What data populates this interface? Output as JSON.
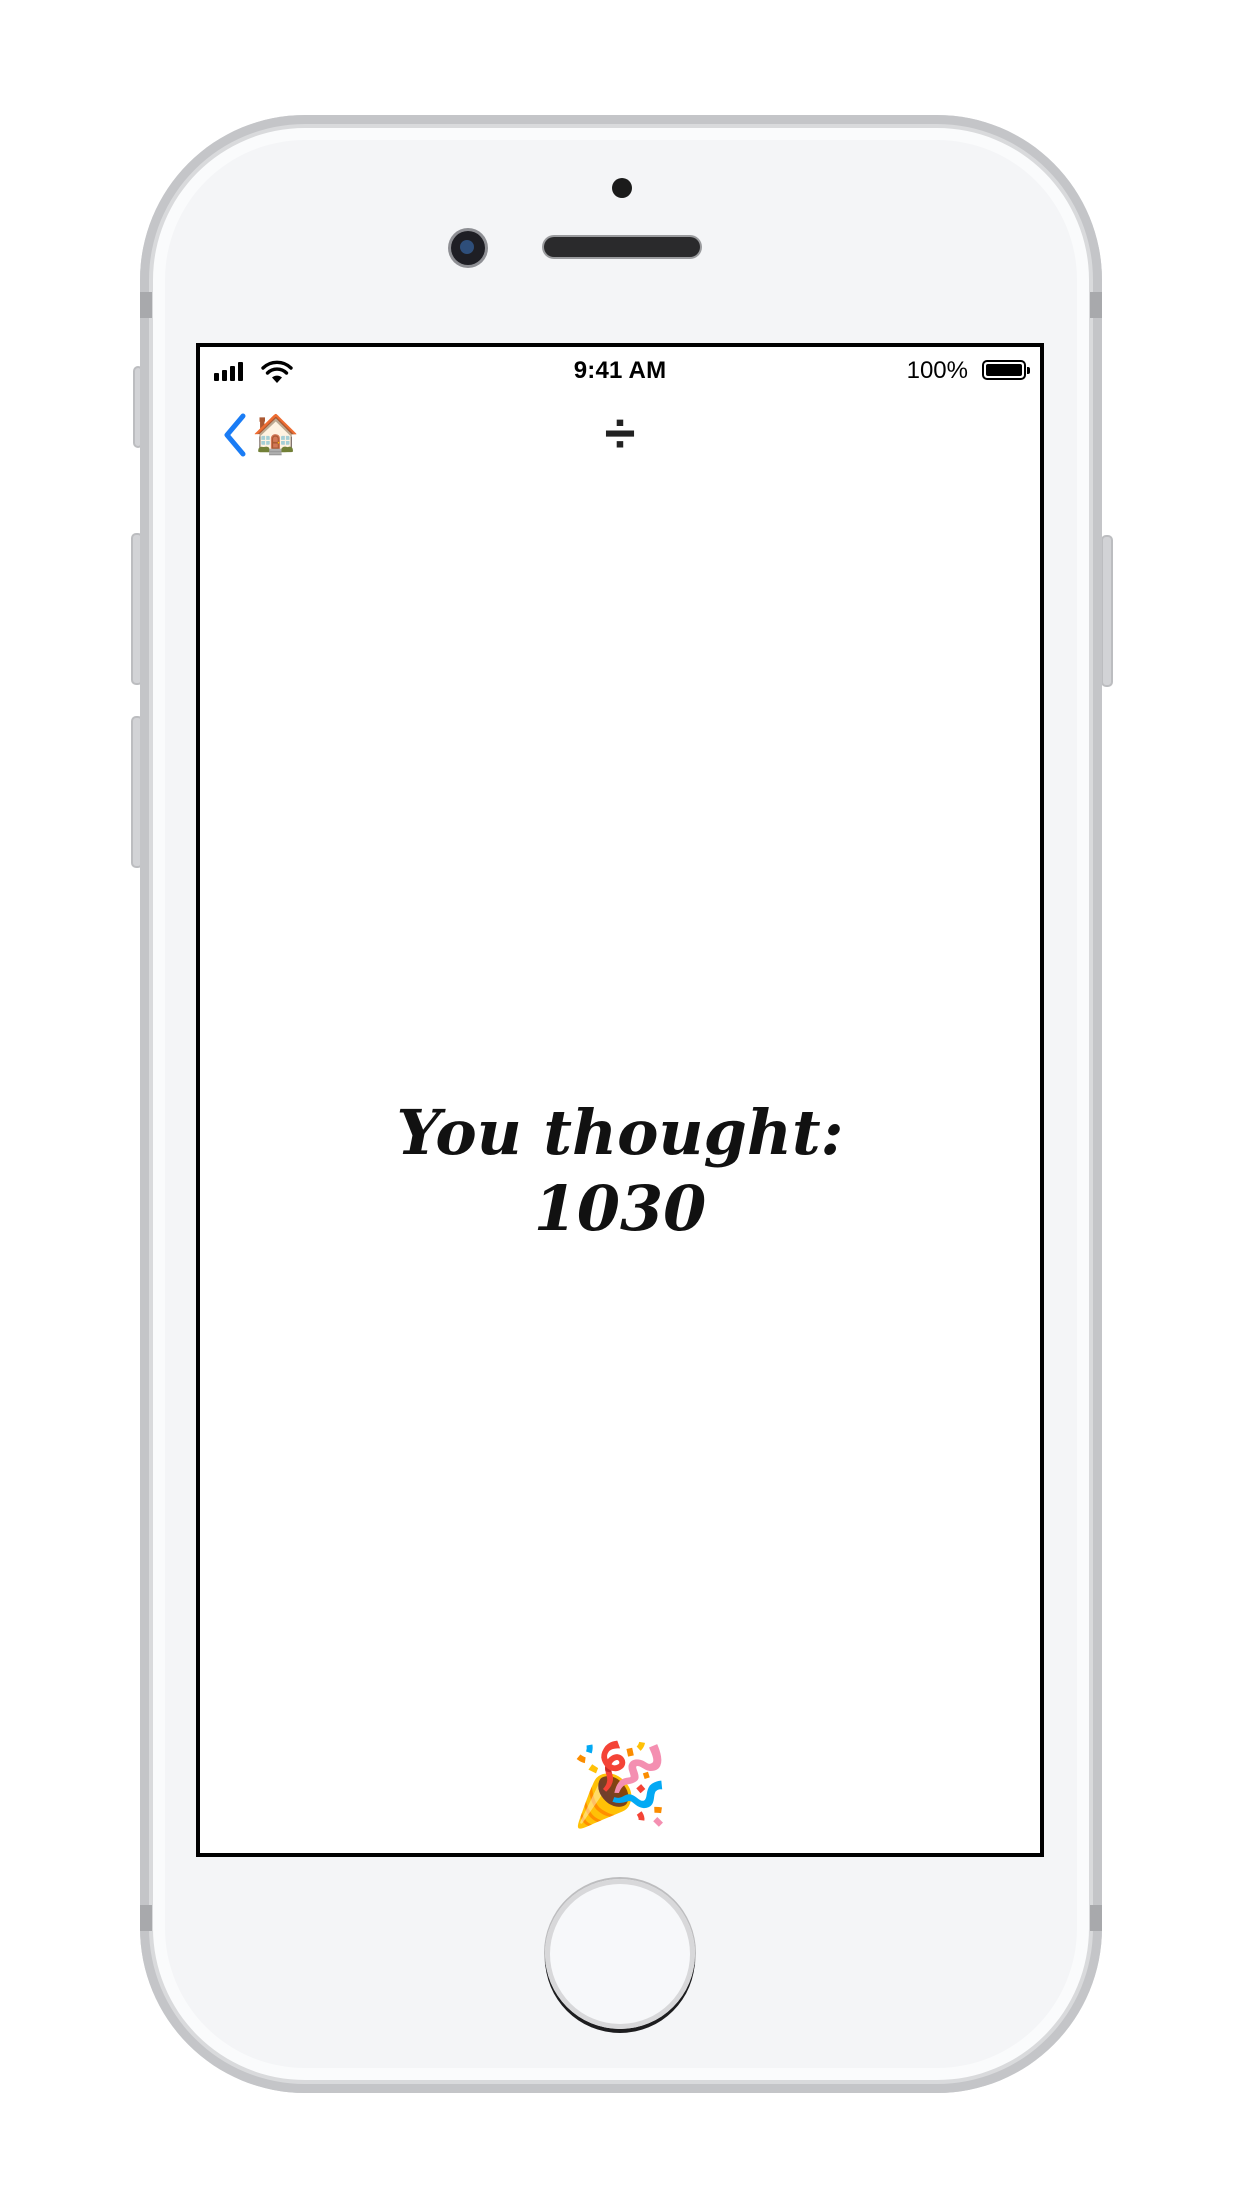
{
  "status_bar": {
    "time": "9:41 AM",
    "battery_percent": "100%",
    "battery_level": 1.0,
    "signal_icon": "cellular-signal-icon",
    "wifi_icon": "wifi-icon",
    "battery_icon": "battery-icon"
  },
  "nav": {
    "back_chevron_icon": "chevron-left-icon",
    "back_emoji": "🏠",
    "title": "÷",
    "accent_color": "#1a7cf5"
  },
  "main": {
    "label": "You thought:",
    "value": "1030"
  },
  "footer": {
    "party_emoji": "🎉"
  }
}
